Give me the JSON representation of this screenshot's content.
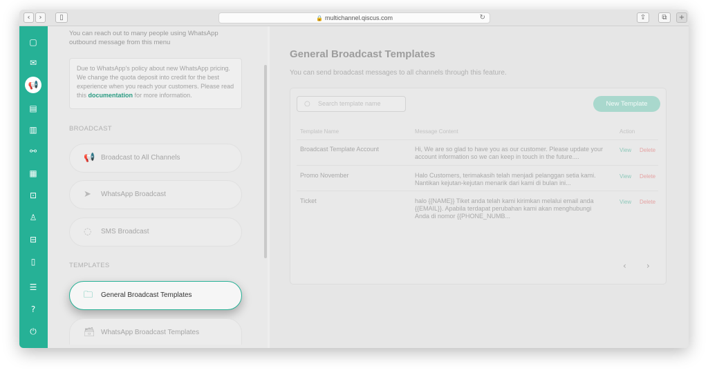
{
  "browser": {
    "url": "multichannel.qiscus.com",
    "back_icon": "‹",
    "forward_icon": "›",
    "sidebar_icon": "▯",
    "share_icon": "⇪",
    "tabs_icon": "⧉",
    "newtab_icon": "+"
  },
  "sidebar": {
    "icons": [
      "chat-icon",
      "mail-icon",
      "broadcast-icon",
      "contact-card-icon",
      "analytics-icon",
      "integration-icon",
      "apps-icon",
      "bot-icon",
      "agent-icon",
      "ticket-icon",
      "mobile-icon",
      "settings-icon",
      "help-icon",
      "logout-icon"
    ],
    "active": "broadcast-icon",
    "accent": "#26b196"
  },
  "leftpanel": {
    "intro": "You can reach out to many people using WhatsApp outbound message from this menu",
    "policy_text": "Due to WhatsApp's policy about new WhatsApp pricing. We change the quota deposit into credit for the best experience when you reach your customers. Please read this",
    "policy_link": "documentation",
    "policy_suffix": "for more information.",
    "broadcast_section": "BROADCAST",
    "broadcast_items": [
      {
        "label": "Broadcast to All Channels",
        "icon": "megaphone-icon"
      },
      {
        "label": "WhatsApp Broadcast",
        "icon": "send-icon"
      },
      {
        "label": "SMS Broadcast",
        "icon": "sms-icon"
      }
    ],
    "templates_section": "TEMPLATES",
    "template_items": [
      {
        "label": "General Broadcast Templates",
        "icon": "folder-icon"
      },
      {
        "label": "WhatsApp Broadcast Templates",
        "icon": "archive-icon"
      }
    ]
  },
  "main": {
    "title": "General Broadcast Templates",
    "subtitle": "You can send broadcast messages to all channels through this feature.",
    "search_placeholder": "Search template name",
    "new_template": "New Template",
    "columns": [
      "Template Name",
      "Message Content",
      "Action"
    ],
    "rows": [
      {
        "name": "Broadcast Template Account",
        "content": [
          "Hi, We are so glad to have you as our customer. Please update your",
          "account information so we can keep in touch in the future...."
        ],
        "view": "View",
        "delete": "Delete"
      },
      {
        "name": "Promo November",
        "content": [
          "Halo Customers, terimakasih telah menjadi pelanggan setia kami.",
          "Nantikan kejutan-kejutan menarik dari kami di bulan ini..."
        ],
        "view": "View",
        "delete": "Delete"
      },
      {
        "name": "Ticket",
        "content": [
          "halo {{NAME}} Tiket anda telah kami kirimkan melalui email anda",
          "{{EMAIL}}. Apabila terdapat perubahan kami akan menghubungi",
          "Anda di nomor {{PHONE_NUMB..."
        ],
        "view": "View",
        "delete": "Delete"
      }
    ],
    "prev": "‹",
    "next": "›"
  }
}
